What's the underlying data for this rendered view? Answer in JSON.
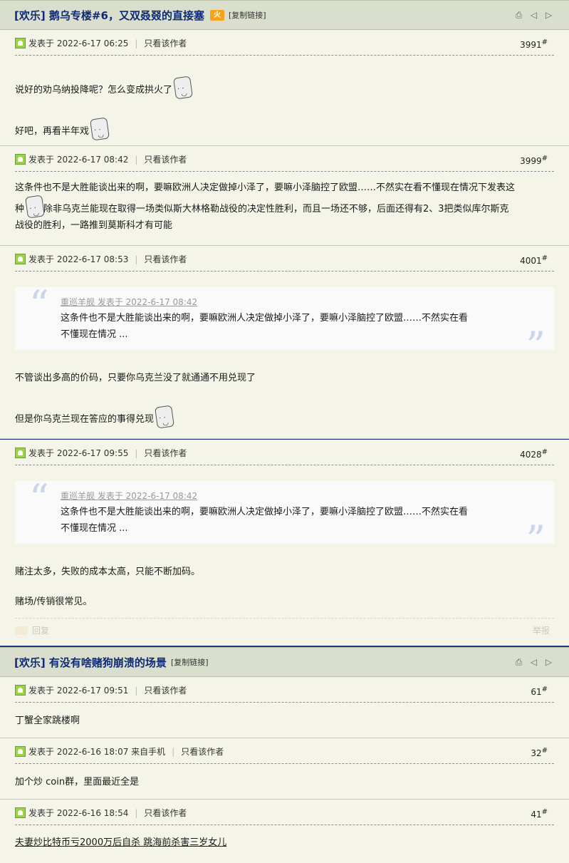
{
  "colors": {
    "header_bg": "#d9dfcc",
    "title": "#0e2a78",
    "accent_border": "#1f3b80"
  },
  "threads": [
    {
      "title": "[欢乐] 鹅乌专楼#6，又双叒叕的直接塞",
      "badge": "火",
      "copy_link": "[复制链接]"
    },
    {
      "title": "[欢乐] 有没有啥赌狗崩溃的场景",
      "copy_link": "[复制链接]"
    }
  ],
  "common": {
    "posted_prefix": "发表于",
    "author_only": "只看该作者",
    "sep": "|",
    "reply": "回复",
    "report": "举报"
  },
  "posts": [
    {
      "time": "2022-6-17 06:25",
      "floor": "3991",
      "lines": [
        "说好的劝乌纳投降呢？怎么变成拱火了",
        "好吧，再看半年戏"
      ]
    },
    {
      "time": "2022-6-17 08:42",
      "floor": "3999",
      "text_a": "这条件也不是大胜能谈出来的啊，要嘛欧洲人决定做掉小泽了，要嘛小泽脑控了欧盟……不然实在看不懂现在情况下发表这",
      "text_b": "种",
      "text_c": "除非乌克兰能现在取得一场类似斯大林格勒战役的决定性胜利，而且一场还不够，后面还得有2、3把类似库尔斯克",
      "text_d": "战役的胜利，一路推到莫斯科才有可能"
    },
    {
      "time": "2022-6-17 08:53",
      "floor": "4001",
      "quote_src": "重巡羊舰 发表于 2022-6-17 08:42",
      "quote_l1": "这条件也不是大胜能谈出来的啊，要嘛欧洲人决定做掉小泽了，要嘛小泽脑控了欧盟……不然实在看",
      "quote_l2": "不懂现在情况 ...",
      "lines": [
        "不管谈出多高的价码，只要你乌克兰没了就通通不用兑现了",
        "但是你乌克兰现在答应的事得兑现"
      ]
    },
    {
      "time": "2022-6-17 09:55",
      "floor": "4028",
      "quote_src": "重巡羊舰 发表于 2022-6-17 08:42",
      "quote_l1": "这条件也不是大胜能谈出来的啊，要嘛欧洲人决定做掉小泽了，要嘛小泽脑控了欧盟……不然实在看",
      "quote_l2": "不懂现在情况 ...",
      "lines": [
        "赌注太多，失败的成本太高，只能不断加码。",
        "赌场/传销很常见。"
      ]
    },
    {
      "time": "2022-6-17 09:51",
      "floor": "61",
      "lines": [
        "丁蟹全家跳楼啊"
      ]
    },
    {
      "time": "2022-6-16 18:07",
      "suffix": "来自手机",
      "floor": "32",
      "lines": [
        "加个炒 coin群，里面最近全是"
      ]
    },
    {
      "time": "2022-6-16 18:54",
      "floor": "41",
      "lines": [
        "夫妻炒比特币亏2000万后自杀 跳海前杀害三岁女儿"
      ]
    }
  ]
}
